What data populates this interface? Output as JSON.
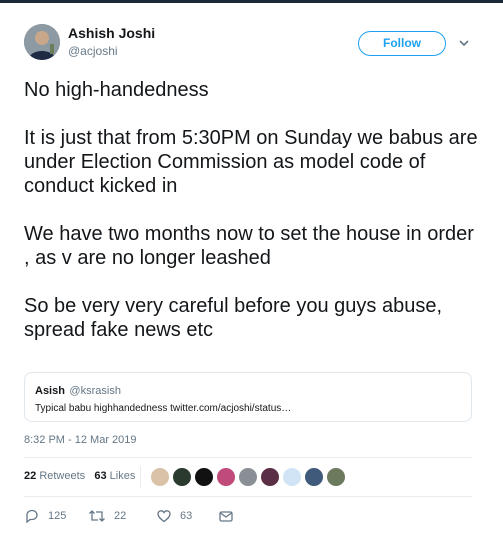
{
  "author": {
    "name": "Ashish Joshi",
    "handle": "@acjoshi"
  },
  "follow_label": "Follow",
  "tweet": {
    "paragraphs": [
      "No high-handedness",
      "It is just that from 5:30PM on Sunday we babus are under Election Commission as model code of conduct kicked in",
      "We have two months now to set the house in order , as v are no longer leashed",
      "So be very very careful before you guys abuse, spread fake news etc"
    ]
  },
  "quoted": {
    "name": "Asish",
    "handle": "@ksrasish",
    "text": "Typical babu highhandedness twitter.com/acjoshi/status…"
  },
  "timestamp": "8:32 PM - 12 Mar 2019",
  "stats": {
    "retweets": "22",
    "retweets_label": "Retweets",
    "likes": "63",
    "likes_label": "Likes"
  },
  "liker_colors": [
    "#d9c2a8",
    "#2b3a2e",
    "#111111",
    "#c04a7a",
    "#8a8f96",
    "#5a2f45",
    "#d0e4f5",
    "#3f5a7a",
    "#6c7a5e"
  ],
  "actions": {
    "replies": "125",
    "retweets": "22",
    "likes": "63"
  },
  "colors": {
    "accent": "#1da1f2",
    "muted": "#657786"
  }
}
